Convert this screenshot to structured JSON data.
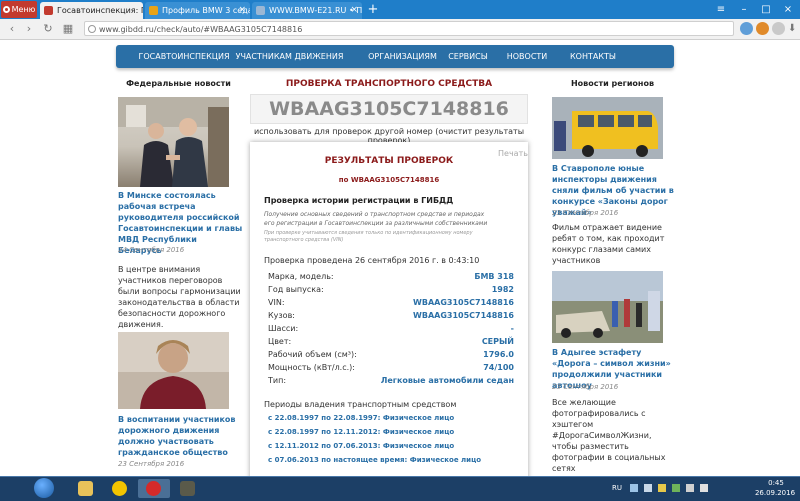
{
  "browser": {
    "menu_label": "Меню",
    "tabs": [
      {
        "title": "Госавтоинспекция: Пров",
        "active": true
      },
      {
        "title": "Профиль BMW 3 седан",
        "active": false
      },
      {
        "title": "WWW.BMW-E21.RU • Пр",
        "active": false
      }
    ],
    "url": "www.gibdd.ru/check/auto/#WBAAG3105C7148816"
  },
  "nav": {
    "items": [
      "ГОСАВТОИНСПЕКЦИЯ",
      "УЧАСТНИКАМ ДВИЖЕНИЯ",
      "ОРГАНИЗАЦИЯМ",
      "СЕРВИСЫ",
      "НОВОСТИ",
      "КОНТАКТЫ"
    ]
  },
  "left": {
    "heading": "Федеральные новости",
    "news": [
      {
        "title": "В Минске состоялась рабочая встреча руководителя российской Госавтоинспекции и главы МВД Республики Беларусь",
        "date": "24 Сентября 2016",
        "text": "В центре внимания участников переговоров были вопросы гармонизации законодательства в области безопасности дорожного движения."
      },
      {
        "title": "В воспитании участников дорожного движения должно участвовать гражданское общество",
        "date": "23 Сентября 2016"
      }
    ]
  },
  "right": {
    "heading": "Новости регионов",
    "news": [
      {
        "title": "В Ставрополе юные инспекторы движения сняли фильм об участии в конкурсе «Законы дорог уважай»",
        "date": "23 Сентября 2016",
        "text": "Фильм отражает видение ребят о том, как проходит конкурс глазами самих участников"
      },
      {
        "title": "В Адыгее эстафету «Дорога – символ жизни» продолжили участники автошоу",
        "date": "23 Сентября 2016",
        "text": "Все желающие фотографировались с хэштегом #ДорогаСимволЖизни, чтобы разместить фотографии в социальных сетях"
      }
    ]
  },
  "center": {
    "title": "ПРОВЕРКА ТРАНСПОРТНОГО СРЕДСТВА",
    "vin": "WBAAG3105C7148816",
    "use_other": "использовать для проверок другой номер (очистит результаты проверок)",
    "print_label": "Печать",
    "results_title": "РЕЗУЛЬТАТЫ ПРОВЕРОК",
    "results_sub": "по WBAAG3105C7148816",
    "history_title": "Проверка истории регистрации в ГИБДД",
    "desc": "Получение основных сведений о транспортном средстве и периодах его регистрации в Госавтоинспекции за различными собственниками",
    "tiny": "При проверке учитываются сведения только по идентификационному номеру транспортного средства (VIN)",
    "done": "Проверка проведена 26 сентября 2016 г. в 0:43:10",
    "rows": [
      {
        "label": "Марка, модель:",
        "value": "БМВ 318"
      },
      {
        "label": "Год выпуска:",
        "value": "1982"
      },
      {
        "label": "VIN:",
        "value": "WBAAG3105C7148816"
      },
      {
        "label": "Кузов:",
        "value": "WBAAG3105C7148816"
      },
      {
        "label": "Шасси:",
        "value": "-"
      },
      {
        "label": "Цвет:",
        "value": "СЕРЫЙ"
      },
      {
        "label": "Рабочий объем (см³):",
        "value": "1796.0"
      },
      {
        "label": "Мощность (кВт/л.с.):",
        "value": "74/100"
      },
      {
        "label": "Тип:",
        "value": "Легковые автомобили седан"
      }
    ],
    "periods_title": "Периоды владения транспортным средством",
    "periods": [
      "с 22.08.1997 по 22.08.1997: Физическое лицо",
      "с 22.08.1997 по 12.11.2012: Физическое лицо",
      "с 12.11.2012 по 07.06.2013: Физическое лицо",
      "с 07.06.2013 по настоящее время: Физическое лицо"
    ]
  },
  "taskbar": {
    "lang": "RU",
    "time": "0:45",
    "date": "26.09.2016"
  },
  "colors": {
    "nav": "#2a6fa6",
    "accent_red": "#8b1a1a",
    "link_blue": "#2a6fa6",
    "taskbar": "#1c3f66"
  }
}
